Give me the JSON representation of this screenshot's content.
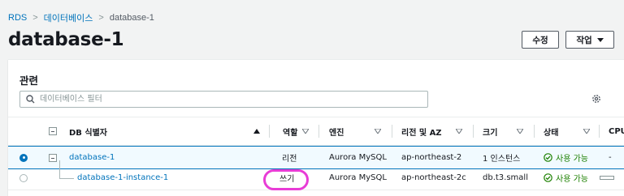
{
  "breadcrumb": {
    "items": [
      "RDS",
      "데이터베이스",
      "database-1"
    ]
  },
  "header": {
    "title": "database-1",
    "edit_label": "수정",
    "actions_label": "작업"
  },
  "panel": {
    "title": "관련",
    "filter_placeholder": "데이터베이스 필터"
  },
  "table": {
    "columns": [
      "DB 식별자",
      "역할",
      "엔진",
      "리전 및 AZ",
      "크기",
      "상태",
      "CPU"
    ],
    "rows": [
      {
        "identifier": "database-1",
        "role": "리전",
        "engine": "Aurora MySQL",
        "region_az": "ap-northeast-2",
        "size": "1 인스턴스",
        "status": "사용 가능",
        "cpu": "-",
        "selected": true
      },
      {
        "identifier": "database-1-instance-1",
        "role": "쓰기",
        "engine": "Aurora MySQL",
        "region_az": "ap-northeast-2c",
        "size": "db.t3.small",
        "status": "사용 가능",
        "cpu": "",
        "selected": false
      }
    ]
  },
  "colors": {
    "link": "#0073bb",
    "status_ok": "#1d8102",
    "highlight": "#e83cd6"
  }
}
